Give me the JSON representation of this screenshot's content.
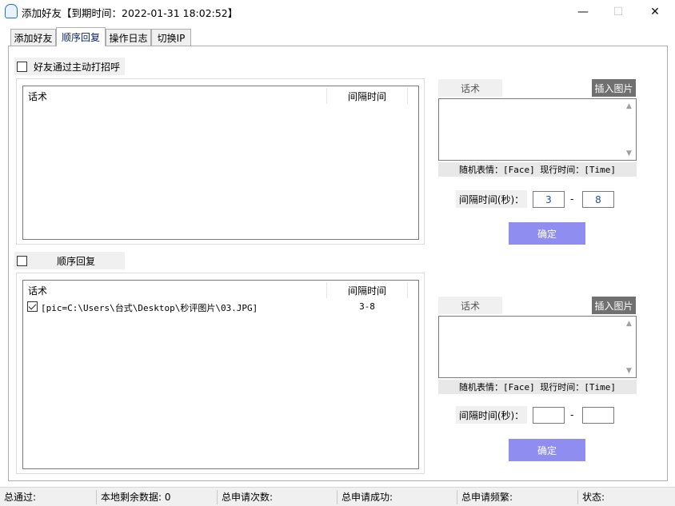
{
  "window": {
    "title": "添加好友【到期时间：2022-01-31 18:02:52】",
    "minimize_glyph": "—",
    "maximize_glyph": "☐",
    "close_glyph": "✕"
  },
  "tabs": [
    {
      "label": "添加好友",
      "active": false
    },
    {
      "label": "顺序回复",
      "active": true
    },
    {
      "label": "操作日志",
      "active": false
    },
    {
      "label": "切换IP",
      "active": false
    }
  ],
  "section1": {
    "checkbox_label": "好友通过主动打招呼",
    "checked": false,
    "list": {
      "columns": [
        "话术",
        "间隔时间"
      ],
      "rows": []
    },
    "right": {
      "script_label": "话术",
      "insert_image_label": "插入图片",
      "textarea_value": "",
      "hint": "随机表情：[Face] 现行时间：[Time]",
      "interval_label": "间隔时间(秒)：",
      "interval_min": "3",
      "interval_dash": "-",
      "interval_max": "8",
      "confirm_label": "确定"
    }
  },
  "section2": {
    "checkbox_label": "顺序回复",
    "checked": false,
    "list": {
      "columns": [
        "话术",
        "间隔时间"
      ],
      "rows": [
        {
          "checked": true,
          "text": "[pic=C:\\Users\\台式\\Desktop\\秒评图片\\03.JPG]",
          "interval": "3-8"
        }
      ]
    },
    "right": {
      "script_label": "话术",
      "insert_image_label": "插入图片",
      "textarea_value": "",
      "hint": "随机表情：[Face] 现行时间：[Time]",
      "interval_label": "间隔时间(秒)：",
      "interval_min": "",
      "interval_dash": "-",
      "interval_max": "",
      "confirm_label": "确定"
    }
  },
  "statusbar": {
    "total_passed": "总通过:",
    "local_remaining": "本地剩余数据: 0",
    "total_requests": "总申请次数:",
    "total_success": "总申请成功:",
    "total_frequent": "总申请频繁:",
    "status": "状态:"
  }
}
